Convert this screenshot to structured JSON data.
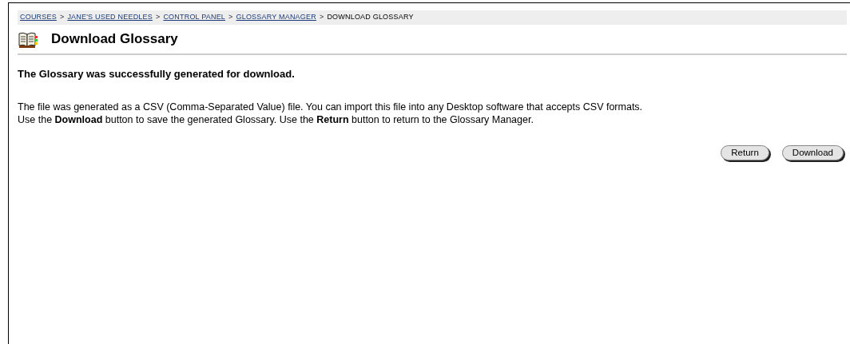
{
  "breadcrumb": [
    {
      "kind": "link",
      "text": "COURSES"
    },
    {
      "kind": "separator",
      "text": ">"
    },
    {
      "kind": "link",
      "text": "JANE'S USED NEEDLES"
    },
    {
      "kind": "separator",
      "text": ">"
    },
    {
      "kind": "link",
      "text": "CONTROL PANEL"
    },
    {
      "kind": "separator",
      "text": ">"
    },
    {
      "kind": "link",
      "text": "GLOSSARY MANAGER"
    },
    {
      "kind": "separator",
      "text": ">"
    },
    {
      "kind": "current",
      "text": "DOWNLOAD GLOSSARY"
    }
  ],
  "page_title": "Download Glossary",
  "success_message": "The Glossary was successfully generated for download.",
  "instructions": [
    "The file was generated as a CSV (Comma-Separated Value) file. You can import this file into any Desktop software that accepts CSV formats.",
    "Use the **Download** button to save the generated Glossary. Use the **Return** button to return to the Glossary Manager."
  ],
  "buttons": [
    "Return",
    "Download"
  ]
}
